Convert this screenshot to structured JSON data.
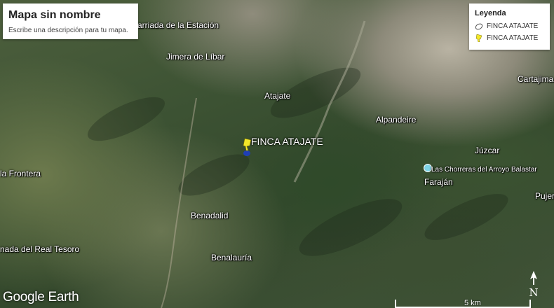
{
  "map": {
    "title": "Mapa sin nombre",
    "description": "Escribe una descripción para tu mapa.",
    "legend": {
      "heading": "Leyenda",
      "items": [
        {
          "label": "FINCA ATAJATE",
          "icon": "polygon-outline-icon"
        },
        {
          "label": "FINCA ATAJATE",
          "icon": "pushpin-icon"
        }
      ]
    },
    "pin": {
      "label": "FINCA ATAJATE",
      "color": "#f2e72a",
      "shadow_color": "#1f3fb5"
    },
    "places": [
      {
        "name": "Barriada de la Estación"
      },
      {
        "name": "Jimera de Líbar"
      },
      {
        "name": "Atajate"
      },
      {
        "name": "Alpandeire"
      },
      {
        "name": "Cartajima"
      },
      {
        "name": "Júzcar"
      },
      {
        "name": "Las Chorreras del Arroyo Balastar"
      },
      {
        "name": "Faraján"
      },
      {
        "name": "Pujer"
      },
      {
        "name": "la Frontera"
      },
      {
        "name": "Benadalid"
      },
      {
        "name": "nada del Real Tesoro"
      },
      {
        "name": "Benalauría"
      }
    ],
    "attribution": "Google Earth",
    "scale_label": "5 km",
    "north_label": "N"
  }
}
